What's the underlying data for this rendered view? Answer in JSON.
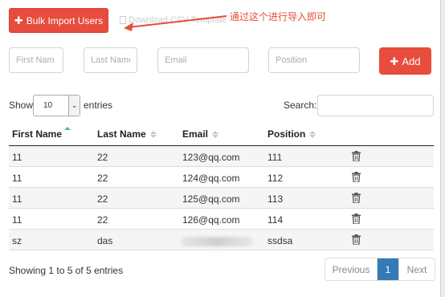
{
  "toolbar": {
    "bulk_import_label": "Bulk Import Users",
    "download_template_label": "Download CSV Template",
    "annotation": "通过这个进行导入即可"
  },
  "form": {
    "first_name_placeholder": "First Nam",
    "last_name_placeholder": "Last Name",
    "email_placeholder": "Email",
    "position_placeholder": "Position",
    "add_label": "Add"
  },
  "controls": {
    "show_label": "Show",
    "entries_value": "10",
    "entries_label": "entries",
    "search_label": "Search:"
  },
  "table": {
    "columns": [
      "First Name",
      "Last Name",
      "Email",
      "Position"
    ],
    "rows": [
      [
        "11",
        "22",
        "123@qq.com",
        "111"
      ],
      [
        "11",
        "22",
        "124@qq.com",
        "112"
      ],
      [
        "11",
        "22",
        "125@qq.com",
        "113"
      ],
      [
        "11",
        "22",
        "126@qq.com",
        "114"
      ],
      [
        "sz",
        "das",
        "",
        "ssdsa"
      ]
    ]
  },
  "footer": {
    "info": "Showing 1 to 5 of 5 entries",
    "previous": "Previous",
    "page": "1",
    "next": "Next"
  },
  "colors": {
    "accent": "#e74c3c",
    "pager_active": "#337ab7",
    "sort_active": "#3dbdb0"
  }
}
